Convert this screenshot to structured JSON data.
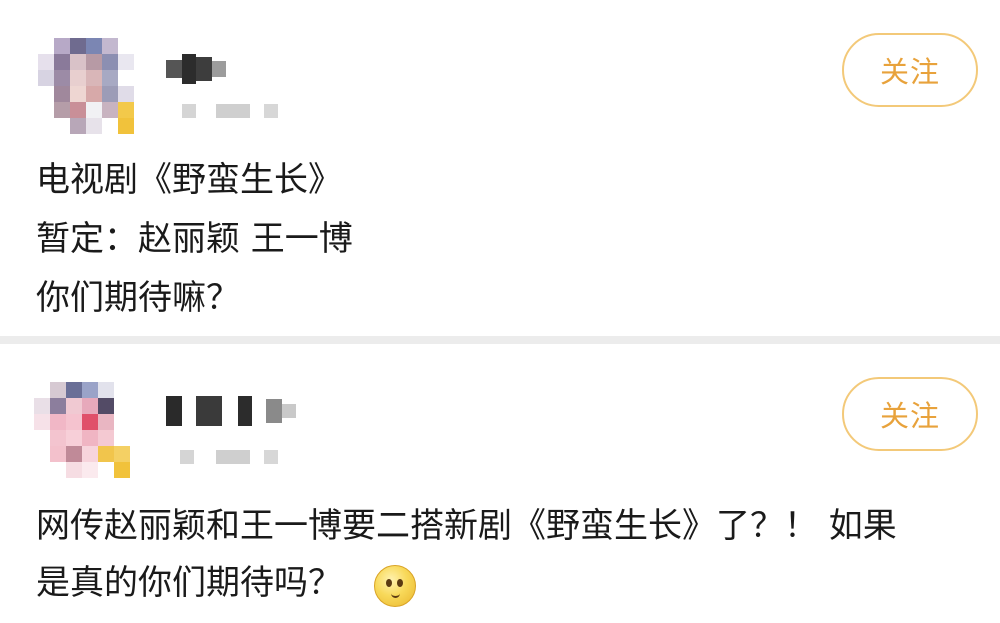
{
  "posts": [
    {
      "follow_label": "关注",
      "lines": [
        "电视剧《野蛮生长》",
        "暂定：赵丽颖 王一博",
        "你们期待嘛？"
      ]
    },
    {
      "follow_label": "关注",
      "lines": [
        "网传赵丽颖和王一博要二搭新剧《野蛮生长》了？！ 如果",
        "是真的你们期待吗？"
      ],
      "emoji": "thinking-face-icon"
    }
  ],
  "colors": {
    "follow_text": "#e8a23b",
    "follow_border": "#f3c979",
    "divider": "#ececec"
  }
}
